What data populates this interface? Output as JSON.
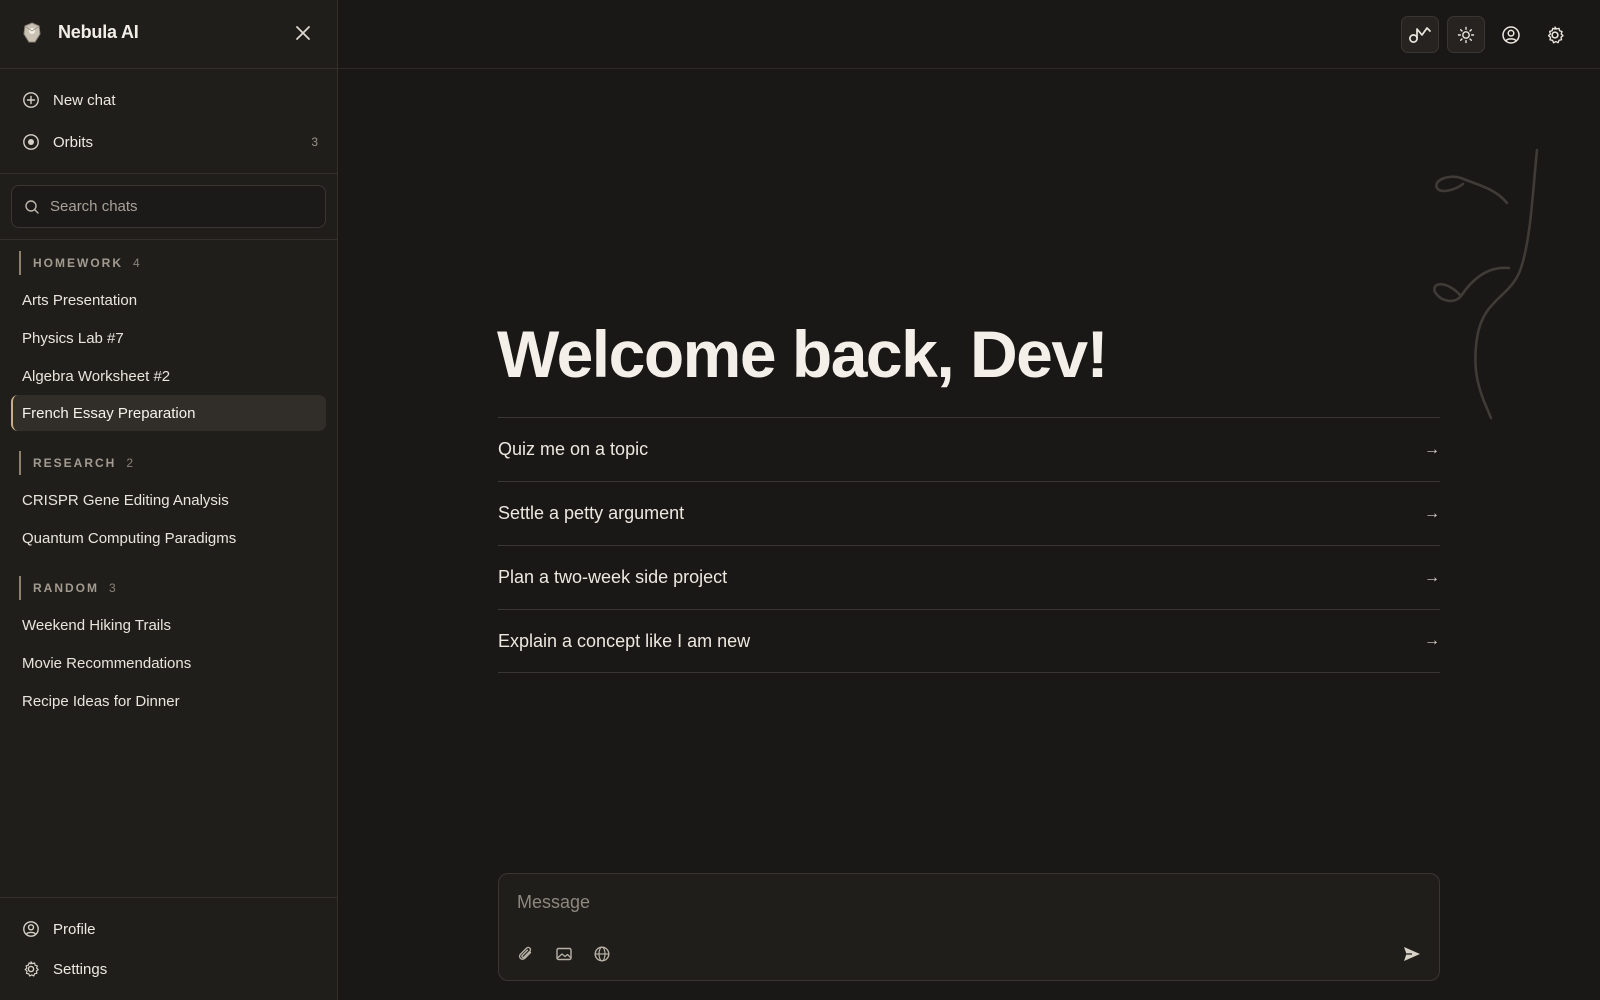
{
  "app": {
    "title": "Nebula AI"
  },
  "sidebar": {
    "nav": [
      {
        "label": "New chat",
        "icon": "plus-circle-icon"
      },
      {
        "label": "Orbits",
        "icon": "orbit-icon",
        "count": "3"
      }
    ],
    "search": {
      "placeholder": "Search chats"
    },
    "groups": [
      {
        "name": "HOMEWORK",
        "count": "4",
        "items": [
          "Arts Presentation",
          "Physics Lab #7",
          "Algebra Worksheet #2",
          "French Essay Preparation"
        ]
      },
      {
        "name": "RESEARCH",
        "count": "2",
        "items": [
          "CRISPR Gene Editing Analysis",
          "Quantum Computing Paradigms"
        ]
      },
      {
        "name": "RANDOM",
        "count": "3",
        "items": [
          "Weekend Hiking Trails",
          "Movie Recommendations",
          "Recipe Ideas for Dinner"
        ]
      }
    ],
    "active_item": "French Essay Preparation",
    "footer": [
      {
        "label": "Profile",
        "icon": "user-circle-icon"
      },
      {
        "label": "Settings",
        "icon": "gear-icon"
      }
    ]
  },
  "topbar": {
    "buttons": [
      "model-switch-icon",
      "sun-icon",
      "user-circle-icon",
      "gear-icon"
    ]
  },
  "main": {
    "welcome": "Welcome back, Dev!",
    "suggestions": [
      {
        "label": "Quiz me on a topic",
        "arrow": "→"
      },
      {
        "label": "Settle a petty argument",
        "arrow": "→"
      },
      {
        "label": "Plan a two-week side project",
        "arrow": "→"
      },
      {
        "label": "Explain a concept like I am new",
        "arrow": "→"
      }
    ]
  },
  "composer": {
    "placeholder": "Message",
    "tools": [
      "paperclip-icon",
      "image-icon",
      "globe-icon"
    ],
    "send_icon": "send-icon"
  },
  "colors": {
    "background": "#1a1816",
    "sidebar": "#201e1b",
    "accent": "#c7b089",
    "text": "#ede8e0"
  }
}
